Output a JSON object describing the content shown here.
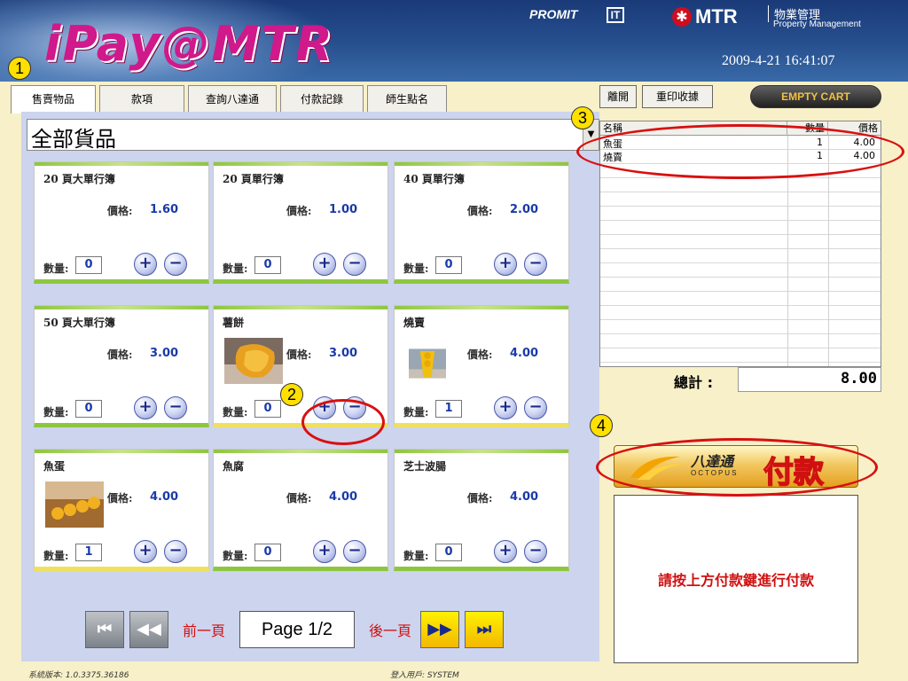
{
  "header": {
    "logo": "iPay@MTR",
    "promit": "PROMIT",
    "it_badge": "IT",
    "mtr_symbol": "✱",
    "mtr_text": "MTR",
    "pm_cn": "物業管理",
    "pm_en": "Property Management",
    "datetime": "2009-4-21 16:41:07"
  },
  "callouts": [
    "1",
    "2",
    "3",
    "4"
  ],
  "tabs": [
    {
      "label": "售賣物品",
      "active": true
    },
    {
      "label": "款項"
    },
    {
      "label": "查詢八達通"
    },
    {
      "label": "付款記錄"
    },
    {
      "label": "師生點名"
    }
  ],
  "category": {
    "value": "全部貨品"
  },
  "card_labels": {
    "price": "價格:",
    "qty": "數量:"
  },
  "products": [
    {
      "name": "20 頁大單行簿",
      "price": "1.60",
      "qty": "0"
    },
    {
      "name": "20 頁單行簿",
      "price": "1.00",
      "qty": "0"
    },
    {
      "name": "40 頁單行簿",
      "price": "2.00",
      "qty": "0"
    },
    {
      "name": "50 頁大單行簿",
      "price": "3.00",
      "qty": "0"
    },
    {
      "name": "薯餅",
      "price": "3.00",
      "qty": "0"
    },
    {
      "name": "燒賣",
      "price": "4.00",
      "qty": "1"
    },
    {
      "name": "魚蛋",
      "price": "4.00",
      "qty": "1"
    },
    {
      "name": "魚腐",
      "price": "4.00",
      "qty": "0"
    },
    {
      "name": "芝士波腸",
      "price": "4.00",
      "qty": "0"
    }
  ],
  "pager": {
    "prev": "前一頁",
    "page": "Page 1/2",
    "next": "後一頁"
  },
  "footer": {
    "version": "系統版本: 1.0.3375.36186",
    "user": "登入用戶: SYSTEM"
  },
  "right": {
    "leave_button": "離開",
    "reprint_button": "重印收據",
    "empty_cart": "EMPTY CART"
  },
  "cart": {
    "headers": {
      "name": "名稱",
      "qty": "數量",
      "price": "價格"
    },
    "rows": [
      {
        "name": "魚蛋",
        "qty": "1",
        "price": "4.00"
      },
      {
        "name": "燒賣",
        "qty": "1",
        "price": "4.00"
      }
    ],
    "total_label": "總計 :",
    "total": "8.00"
  },
  "payment": {
    "octopus_cn": "八達通",
    "octopus_en": "OCTOPUS",
    "pay_label": "付款",
    "message": "請按上方付款鍵進行付款"
  },
  "colors": {
    "accent_red": "#d01010",
    "price_blue": "#1a3aa8",
    "card_green": "#8ec63f",
    "header_blue": "#27508f"
  }
}
